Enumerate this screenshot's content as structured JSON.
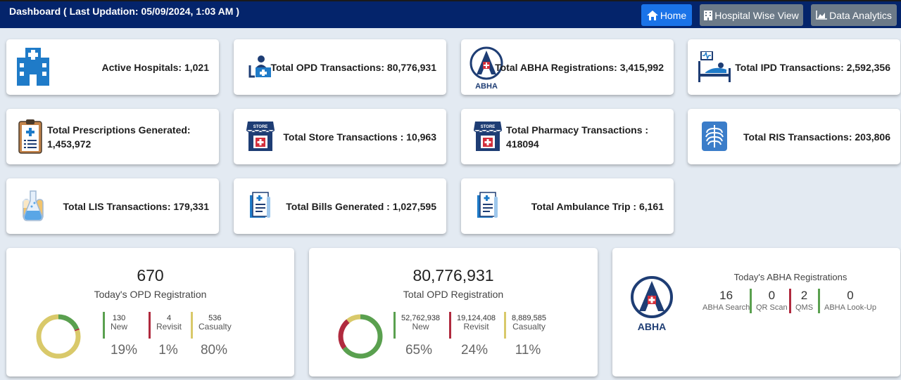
{
  "header": {
    "title": "Dashboard ( Last Updation: 05/09/2024, 1:03 AM )",
    "home": "Home",
    "hospital_wise": "Hospital Wise View",
    "analytics": "Data Analytics"
  },
  "stats": [
    {
      "label": "Active Hospitals: 1,021",
      "icon": "hospital-icon"
    },
    {
      "label": "Total OPD Transactions: 80,776,931",
      "icon": "doctor-desk-icon"
    },
    {
      "label": "Total ABHA Registrations: 3,415,992",
      "icon": "abha-logo-icon"
    },
    {
      "label": "Total IPD Transactions: 2,592,356",
      "icon": "patient-bed-icon"
    },
    {
      "label": "Total Prescriptions Generated: 1,453,972",
      "icon": "clipboard-icon"
    },
    {
      "label": "Total Store Transactions : 10,963",
      "icon": "store-icon"
    },
    {
      "label": "Total Pharmacy Transactions : 418094",
      "icon": "pharmacy-store-icon"
    },
    {
      "label": "Total RIS Transactions: 203,806",
      "icon": "xray-icon"
    },
    {
      "label": "Total LIS Transactions: 179,331",
      "icon": "lab-flask-icon"
    },
    {
      "label": "Total Bills Generated : 1,027,595",
      "icon": "bill-icon"
    },
    {
      "label": "Total Ambulance Trip : 6,161",
      "icon": "ambulance-document-icon"
    }
  ],
  "today_opd": {
    "value": "670",
    "title": "Today's OPD Registration",
    "segments": [
      {
        "value": "130",
        "name": "New",
        "pct": "19%",
        "color": "#5aa04f"
      },
      {
        "value": "4",
        "name": "Revisit",
        "pct": "1%",
        "color": "#b02a3e"
      },
      {
        "value": "536",
        "name": "Casualty",
        "pct": "80%",
        "color": "#d9c96a"
      }
    ]
  },
  "total_opd": {
    "value": "80,776,931",
    "title": "Total OPD Registration",
    "segments": [
      {
        "value": "52,762,938",
        "name": "New",
        "pct": "65%",
        "color": "#5aa04f"
      },
      {
        "value": "19,124,408",
        "name": "Revisit",
        "pct": "24%",
        "color": "#b02a3e"
      },
      {
        "value": "8,889,585",
        "name": "Casualty",
        "pct": "11%",
        "color": "#d9c96a"
      }
    ]
  },
  "today_abha": {
    "title": "Today's ABHA Registrations",
    "logo_text": "ABHA",
    "segments": [
      {
        "value": "16",
        "name": "ABHA Search",
        "color": "#5aa04f"
      },
      {
        "value": "0",
        "name": "QR Scan",
        "color": "#5aa04f"
      },
      {
        "value": "2",
        "name": "QMS",
        "color": "#b02a3e"
      },
      {
        "value": "0",
        "name": "ABHA Look-Up",
        "color": "#5aa04f"
      }
    ]
  },
  "colors": {
    "header_bg": "#04246b",
    "home_btn": "#1a73e8",
    "nav_btn": "#6c7a88",
    "accent_blue": "#1f6fc4"
  }
}
